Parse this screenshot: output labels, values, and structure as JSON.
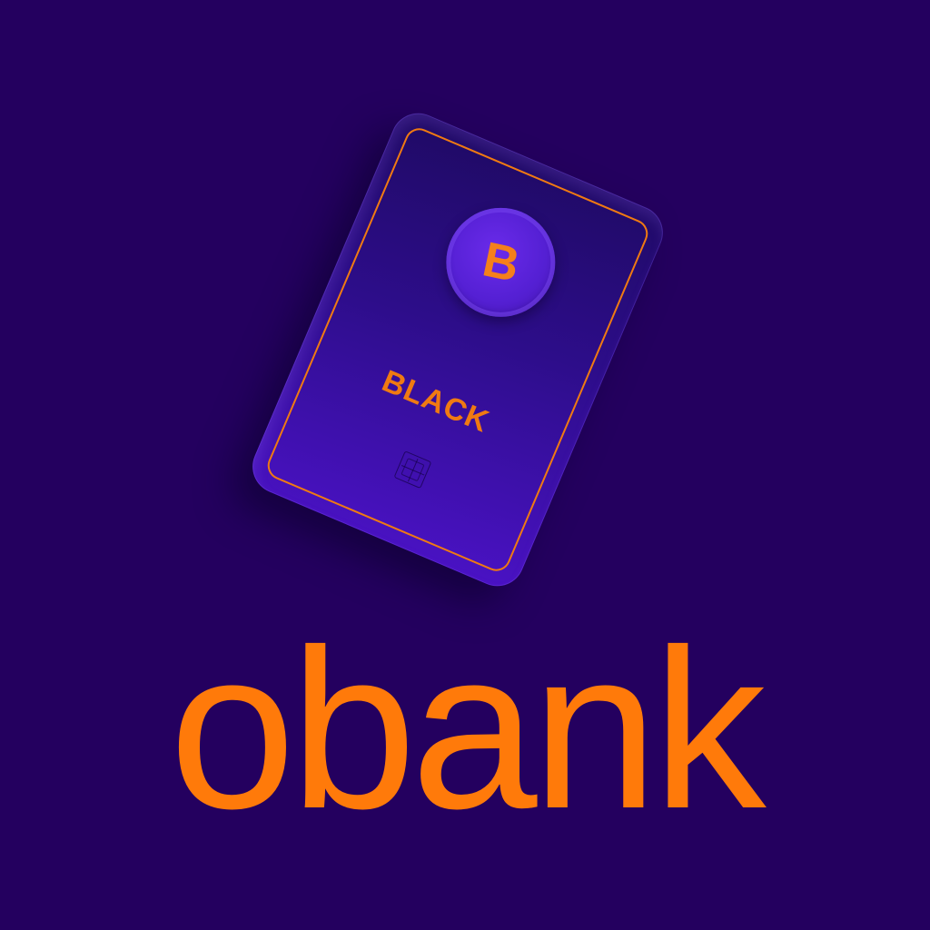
{
  "card": {
    "coin_letter": "B",
    "label": "BLACK"
  },
  "brand": {
    "wordmark": "obank"
  },
  "colors": {
    "background": "#24005f",
    "accent": "#ff7a0a",
    "card_purple": "#4a12c4"
  },
  "icons": {
    "coin": "brand-b-coin-icon",
    "chip": "card-chip-icon"
  }
}
